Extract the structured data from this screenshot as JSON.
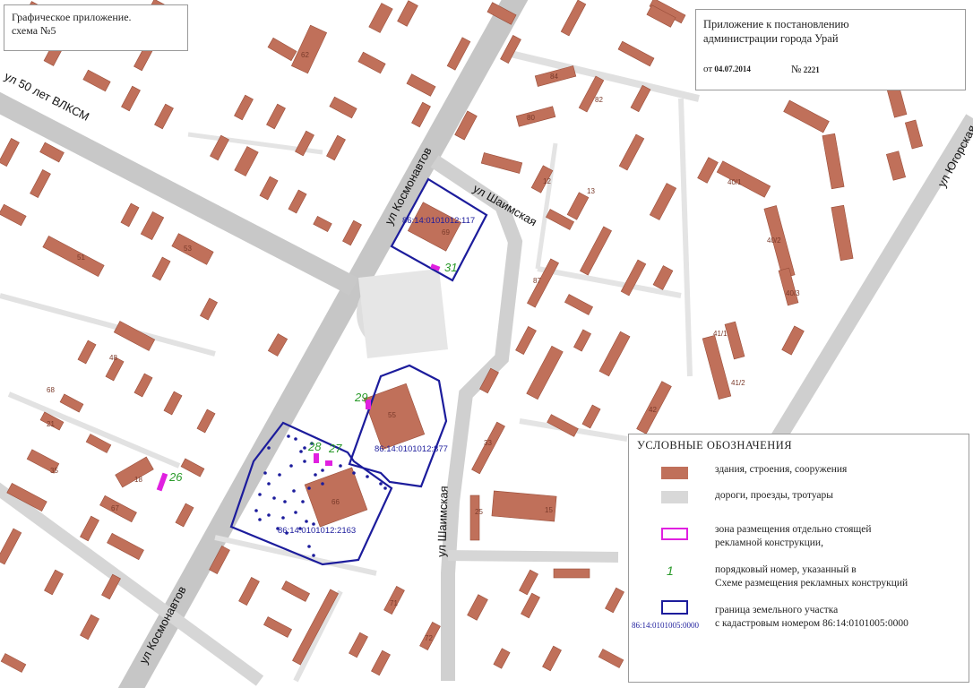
{
  "title_box": {
    "line1": "Графическое приложение.",
    "line2": "схема №5"
  },
  "annex": {
    "line1": "Приложение  к постановлению",
    "line2": "администрации города Урай",
    "date_prefix": "от",
    "date": "04.07.2014",
    "number_prefix": "№",
    "number": "2221"
  },
  "streets": [
    {
      "id": "kosmonavtov-north",
      "name": "ул Космонавтов"
    },
    {
      "id": "kosmonavtov-south",
      "name": "ул Космонавтов"
    },
    {
      "id": "vlksm",
      "name": "ул 50 лет ВЛКСМ"
    },
    {
      "id": "shaimskaya-north",
      "name": "ул Шаимская"
    },
    {
      "id": "shaimskaya-south",
      "name": "ул Шаимская"
    },
    {
      "id": "yugorskaya",
      "name": "ул Югорская"
    }
  ],
  "parcels": [
    {
      "id": "parcel-117",
      "cadastral": "86:14:0101012:117"
    },
    {
      "id": "parcel-877",
      "cadastral": "86:14:0101012:877"
    },
    {
      "id": "parcel-2163",
      "cadastral": "86:14:0101012:2163"
    }
  ],
  "ad_zones": [
    {
      "number": "31"
    },
    {
      "number": "29"
    },
    {
      "number": "28"
    },
    {
      "number": "27"
    },
    {
      "number": "26"
    }
  ],
  "building_numbers": [
    "69",
    "55",
    "66",
    "62",
    "84",
    "80",
    "12",
    "13",
    "15",
    "18",
    "21",
    "25",
    "33",
    "35",
    "40/1",
    "40/2",
    "40/3",
    "41/1",
    "41/2",
    "42",
    "48",
    "51",
    "53",
    "67",
    "68",
    "71",
    "72",
    "82",
    "87"
  ],
  "legend": {
    "title": "УСЛОВНЫЕ  ОБОЗНАЧЕНИЯ",
    "items": [
      {
        "text": "здания, строения, сооружения"
      },
      {
        "text": "дороги, проезды, тротуары"
      },
      {
        "line1": "зона размещения отдельно стоящей",
        "line2": "рекламной конструкции,"
      },
      {
        "symbol": "1",
        "line1": "порядковый номер, указанный в",
        "line2": "Схеме размещения рекламных конструкций"
      },
      {
        "sample_number": "86:14:0101005:0000",
        "line1": "граница земельного участка",
        "line2": "с кадастровым номером 86:14:0101005:0000"
      }
    ]
  },
  "colors": {
    "building": "#c0705a",
    "building_stroke": "#9a4e3a",
    "road": "#d8d8d8",
    "road_dark": "#c4c4c4",
    "parcel_border": "#1c1c9c",
    "ad_zone": "#e020e0",
    "zone_number": "#2a9a2a"
  }
}
